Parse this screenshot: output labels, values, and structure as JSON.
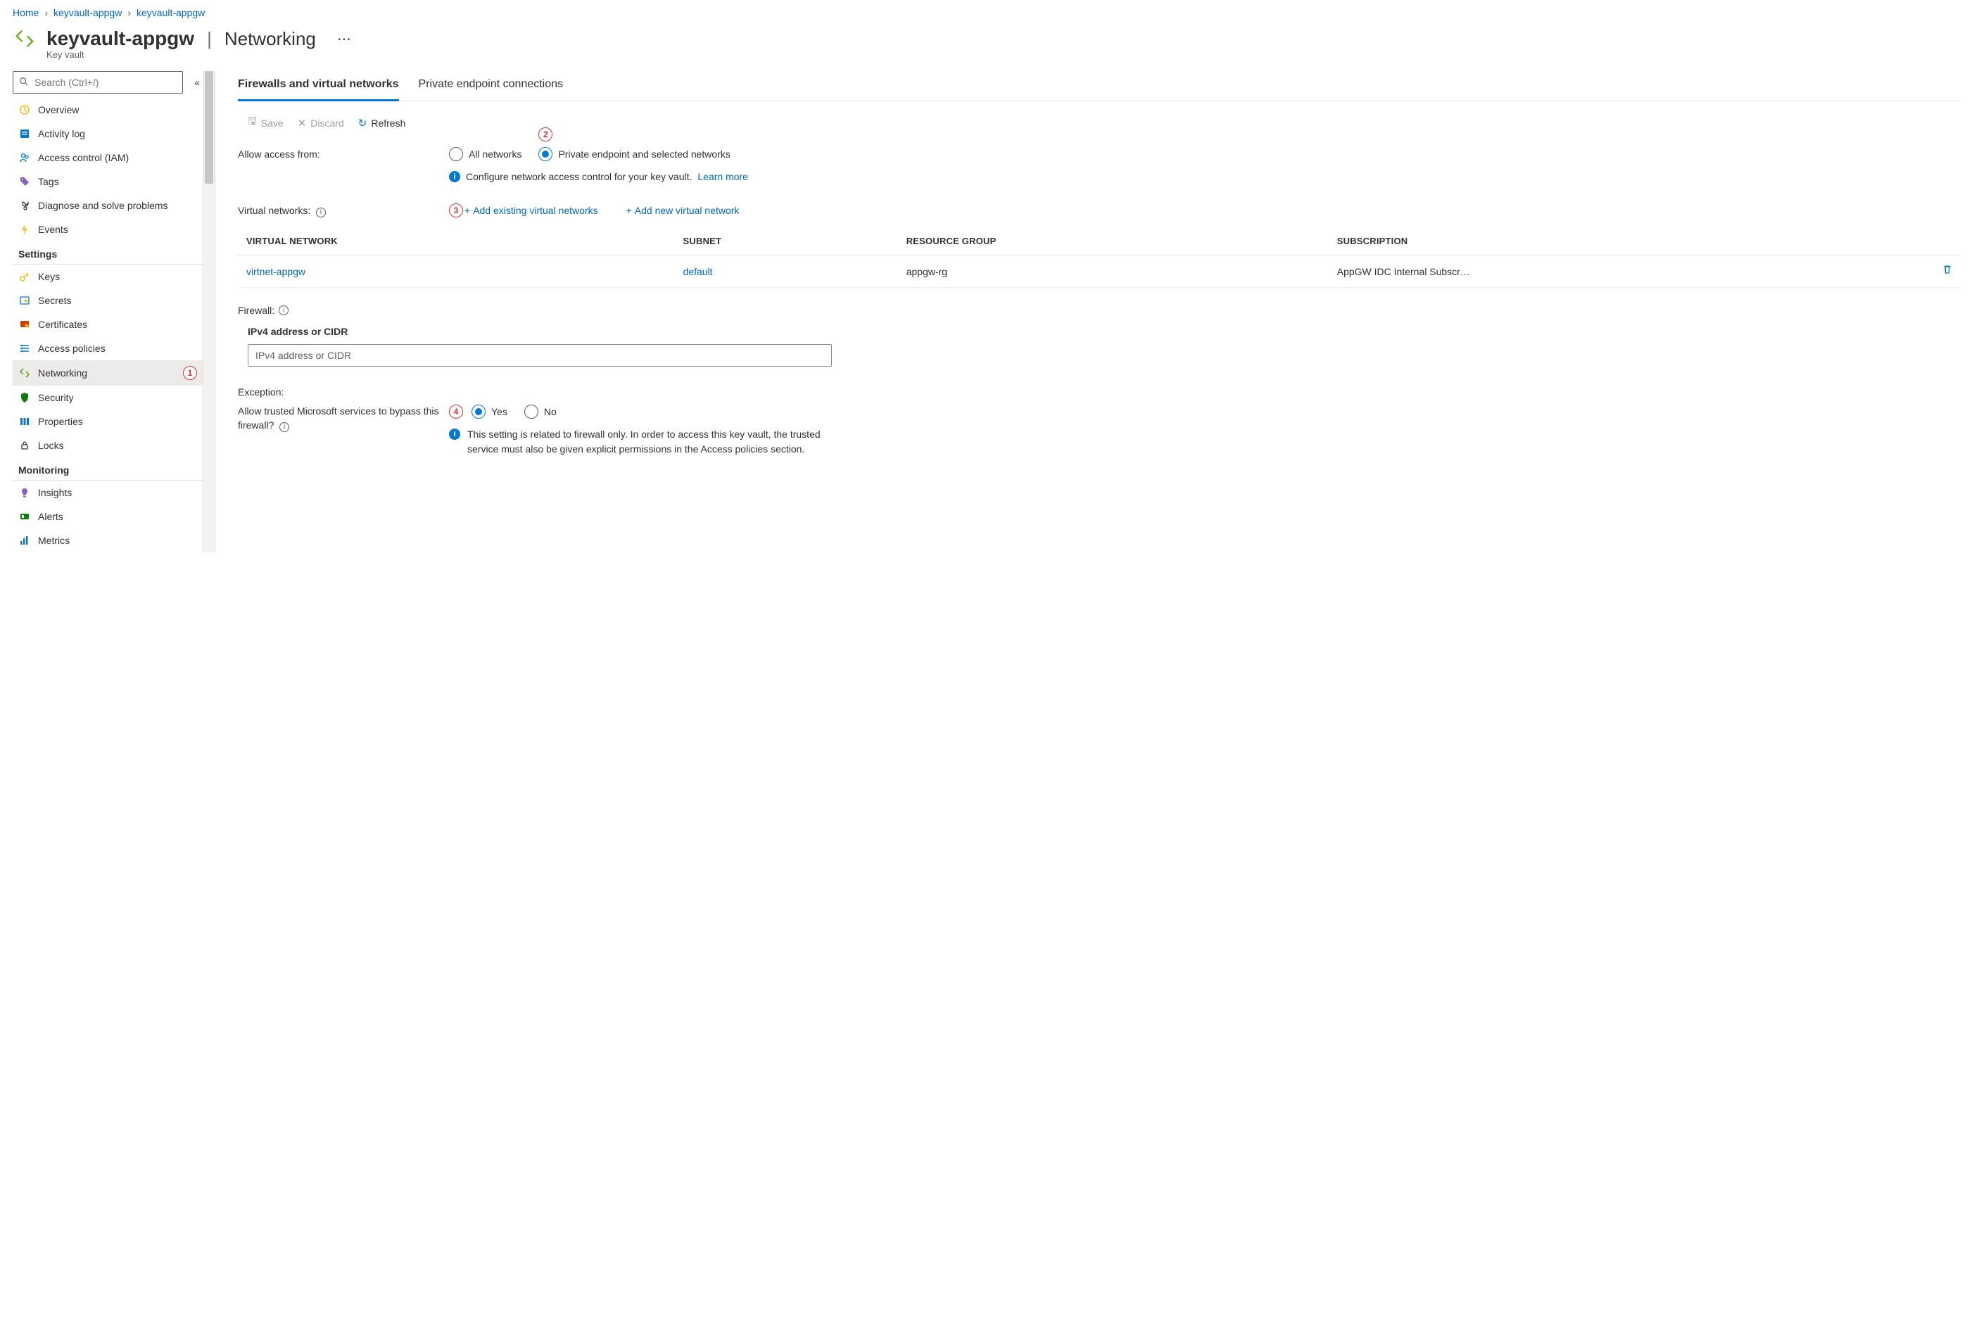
{
  "breadcrumb": [
    {
      "label": "Home"
    },
    {
      "label": "keyvault-appgw"
    },
    {
      "label": "keyvault-appgw"
    }
  ],
  "header": {
    "title": "keyvault-appgw",
    "subtitle": "Networking",
    "resourceType": "Key vault"
  },
  "sidebar": {
    "search_placeholder": "Search (Ctrl+/)",
    "topItems": [
      {
        "label": "Overview",
        "icon": "overview",
        "color": "#ffb900"
      },
      {
        "label": "Activity log",
        "icon": "activity",
        "color": "#0078d4"
      },
      {
        "label": "Access control (IAM)",
        "icon": "iam",
        "color": "#0078d4"
      },
      {
        "label": "Tags",
        "icon": "tags",
        "color": "#8661c5"
      },
      {
        "label": "Diagnose and solve problems",
        "icon": "diagnose",
        "color": "#323130"
      },
      {
        "label": "Events",
        "icon": "events",
        "color": "#ffb900"
      }
    ],
    "groups": [
      {
        "title": "Settings",
        "items": [
          {
            "label": "Keys",
            "icon": "key",
            "color": "#ffb900"
          },
          {
            "label": "Secrets",
            "icon": "secret",
            "color": "#0078d4"
          },
          {
            "label": "Certificates",
            "icon": "cert",
            "color": "#d83b01"
          },
          {
            "label": "Access policies",
            "icon": "policies",
            "color": "#0078d4"
          },
          {
            "label": "Networking",
            "icon": "networking",
            "color": "#57a300",
            "selected": true,
            "annotation": "1"
          },
          {
            "label": "Security",
            "icon": "security",
            "color": "#107c10"
          },
          {
            "label": "Properties",
            "icon": "properties",
            "color": "#0078d4"
          },
          {
            "label": "Locks",
            "icon": "locks",
            "color": "#323130"
          }
        ]
      },
      {
        "title": "Monitoring",
        "items": [
          {
            "label": "Insights",
            "icon": "insights",
            "color": "#8661c5"
          },
          {
            "label": "Alerts",
            "icon": "alerts",
            "color": "#107c10"
          },
          {
            "label": "Metrics",
            "icon": "metrics",
            "color": "#0078d4"
          }
        ]
      }
    ]
  },
  "content": {
    "tabs": [
      {
        "label": "Firewalls and virtual networks",
        "active": true
      },
      {
        "label": "Private endpoint connections",
        "active": false
      }
    ],
    "toolbar": {
      "save": "Save",
      "discard": "Discard",
      "refresh": "Refresh"
    },
    "allowAccess": {
      "label": "Allow access from:",
      "options": {
        "all": "All networks",
        "selected": "Private endpoint and selected networks"
      },
      "selected": "selected",
      "annotation": "2",
      "info": "Configure network access control for your key vault.",
      "learnMore": "Learn more"
    },
    "virtualNetworks": {
      "label": "Virtual networks:",
      "addExisting": "Add existing virtual networks",
      "addNew": "Add new virtual network",
      "annotation": "3",
      "headers": {
        "vnet": "VIRTUAL NETWORK",
        "subnet": "SUBNET",
        "rg": "RESOURCE GROUP",
        "sub": "SUBSCRIPTION"
      },
      "rows": [
        {
          "vnet": "virtnet-appgw",
          "subnet": "default",
          "rg": "appgw-rg",
          "sub": "AppGW IDC Internal Subscr…"
        }
      ]
    },
    "firewall": {
      "label": "Firewall:",
      "ipHeading": "IPv4 address or CIDR",
      "ipPlaceholder": "IPv4 address or CIDR"
    },
    "exception": {
      "sectionLabel": "Exception:",
      "label": "Allow trusted Microsoft services to bypass this firewall?",
      "options": {
        "yes": "Yes",
        "no": "No"
      },
      "selected": "yes",
      "annotation": "4",
      "info": "This setting is related to firewall only. In order to access this key vault, the trusted service must also be given explicit permissions in the Access policies section."
    }
  }
}
